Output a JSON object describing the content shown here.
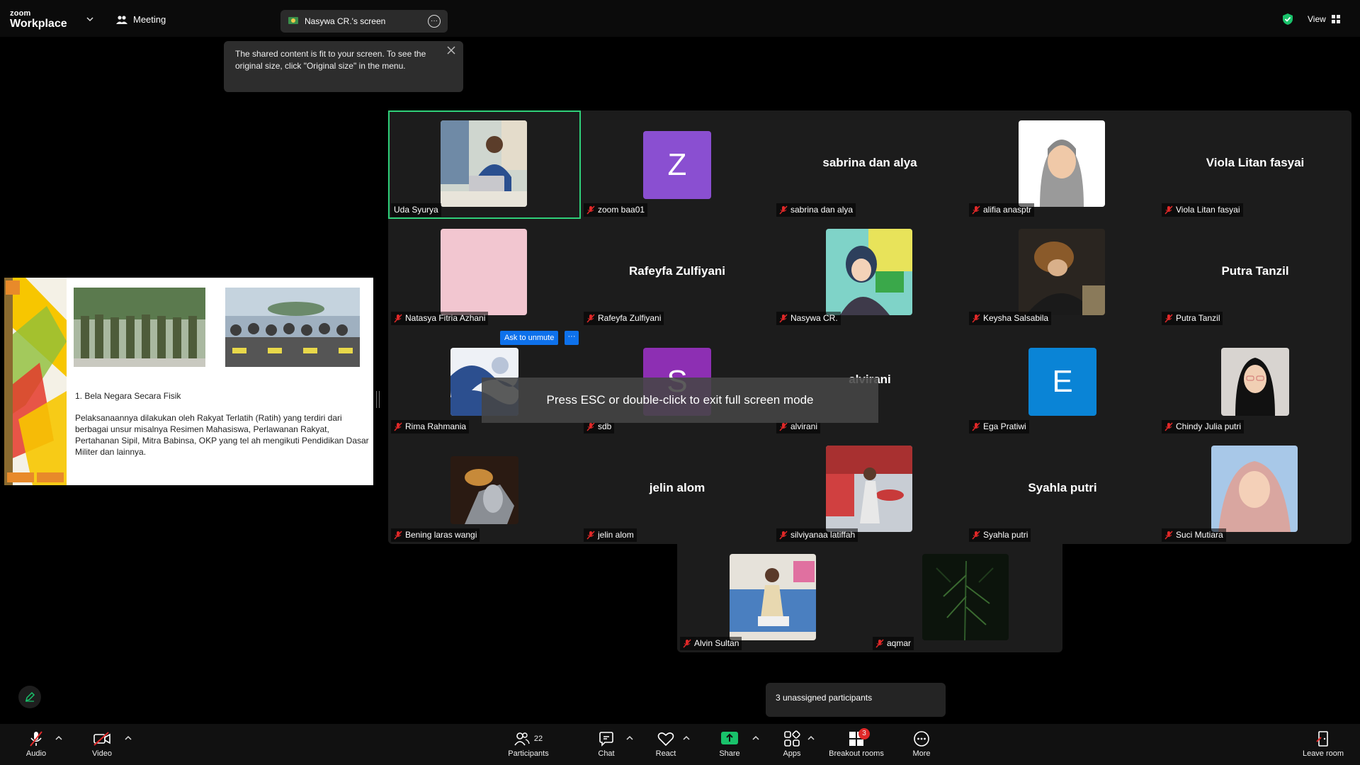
{
  "app": {
    "brand_small": "zoom",
    "brand_large": "Workplace",
    "meeting_label": "Meeting",
    "share_source": "Nasywa CR.'s screen",
    "view_label": "View"
  },
  "tooltip": {
    "text": "The shared content is fit to your screen. To see the original size, click \"Original size\" in the menu."
  },
  "slide": {
    "heading": "1. Bela Negara Secara Fisik",
    "body": "Pelaksanaannya dilakukan oleh Rakyat Terlatih (Ratih) yang terdiri dari berbagai unsur misalnya Resimen Mahasiswa, Perlawanan Rakyat, Pertahanan Sipil, Mitra Babinsa, OKP yang tel ah mengikuti Pendidikan Dasar Militer dan lainnya."
  },
  "gallery": {
    "ask_unmute": "Ask to unmute",
    "ask_more": "···",
    "participants": [
      {
        "name": "Uda Syurya",
        "type": "video",
        "active": true,
        "muted": false
      },
      {
        "name": "zoom baa01",
        "type": "letter",
        "letter": "Z",
        "color": "#8a4fd1",
        "muted": true
      },
      {
        "name": "sabrina dan alya",
        "type": "name",
        "muted": true
      },
      {
        "name": "alifia anasptr",
        "type": "photo",
        "muted": true
      },
      {
        "name": "Viola Litan fasyai",
        "type": "name",
        "muted": true
      },
      {
        "name": "Natasya Fitria Azhani",
        "type": "photo",
        "muted": true
      },
      {
        "name": "Rafeyfa Zulfiyani",
        "type": "name",
        "muted": true
      },
      {
        "name": "Nasywa CR.",
        "type": "photo",
        "muted": true
      },
      {
        "name": "Keysha Salsabila",
        "type": "photo",
        "muted": true
      },
      {
        "name": "Putra Tanzil",
        "type": "name",
        "muted": true
      },
      {
        "name": "Rima Rahmania",
        "type": "photo",
        "muted": true
      },
      {
        "name": "sdb",
        "type": "letter",
        "letter": "S",
        "color": "#8d2fb3",
        "muted": true
      },
      {
        "name": "alvirani",
        "type": "name",
        "muted": true
      },
      {
        "name": "Ega Pratiwi",
        "type": "letter",
        "letter": "E",
        "color": "#0a84d6",
        "muted": true
      },
      {
        "name": "Chindy Julia putri",
        "type": "photo",
        "muted": true
      },
      {
        "name": "Bening laras wangi",
        "type": "photo",
        "muted": true
      },
      {
        "name": "jelin alom",
        "type": "name",
        "muted": true
      },
      {
        "name": "silviyanaa latiffah",
        "type": "photo",
        "muted": true
      },
      {
        "name": "Syahla putri",
        "type": "name",
        "muted": true
      },
      {
        "name": "Suci Mutiara",
        "type": "photo",
        "muted": true
      },
      {
        "name": "Alvin Sultan",
        "type": "photo",
        "muted": false
      },
      {
        "name": "aqmar",
        "type": "photo",
        "muted": true
      }
    ]
  },
  "banner": {
    "esc": "Press ESC or double-click to exit full screen mode"
  },
  "breakout": {
    "unassigned": "3 unassigned participants"
  },
  "toolbar": {
    "audio": "Audio",
    "video": "Video",
    "participants": "Participants",
    "participants_count": "22",
    "chat": "Chat",
    "react": "React",
    "share": "Share",
    "apps": "Apps",
    "breakout_rooms": "Breakout rooms",
    "breakout_badge": "3",
    "more": "More",
    "leave": "Leave room"
  },
  "colors": {
    "active_speaker": "#2fd07a",
    "muted_red": "#e02828",
    "share_green": "#19c26b",
    "accent_blue": "#0e71eb"
  }
}
